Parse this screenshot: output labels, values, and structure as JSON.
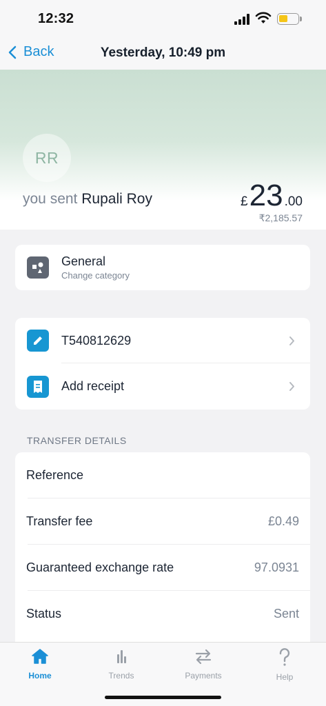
{
  "status_bar": {
    "time": "12:32"
  },
  "nav": {
    "back_label": "Back",
    "title": "Yesterday, 10:49 pm"
  },
  "hero": {
    "avatar_initials": "RR",
    "sent_prefix": "you sent",
    "recipient": "Rupali Roy",
    "currency_symbol": "£",
    "amount_main": "23",
    "amount_decimal": ".00",
    "local_amount": "₹2,185.57"
  },
  "category": {
    "title": "General",
    "subtitle": "Change category",
    "icon": "category-icon"
  },
  "actions": [
    {
      "label": "T540812629",
      "icon": "pencil-icon"
    },
    {
      "label": "Add receipt",
      "icon": "receipt-icon"
    }
  ],
  "transfer_details": {
    "section_title": "TRANSFER DETAILS",
    "rows": [
      {
        "label": "Reference",
        "value": ""
      },
      {
        "label": "Transfer fee",
        "value": "£0.49"
      },
      {
        "label": "Guaranteed exchange rate",
        "value": "97.0931"
      },
      {
        "label": "Status",
        "value": "Sent"
      }
    ]
  },
  "tabs": [
    {
      "label": "Home",
      "icon": "home-icon",
      "active": true
    },
    {
      "label": "Trends",
      "icon": "bar-chart-icon",
      "active": false
    },
    {
      "label": "Payments",
      "icon": "transfer-arrows-icon",
      "active": false
    },
    {
      "label": "Help",
      "icon": "question-icon",
      "active": false
    }
  ],
  "colors": {
    "accent": "#1b8fd6",
    "hero_green": "#cadfd2",
    "category_icon_bg": "#5f6672",
    "action_icon_bg": "#1796d2",
    "battery": "#f5c518"
  }
}
